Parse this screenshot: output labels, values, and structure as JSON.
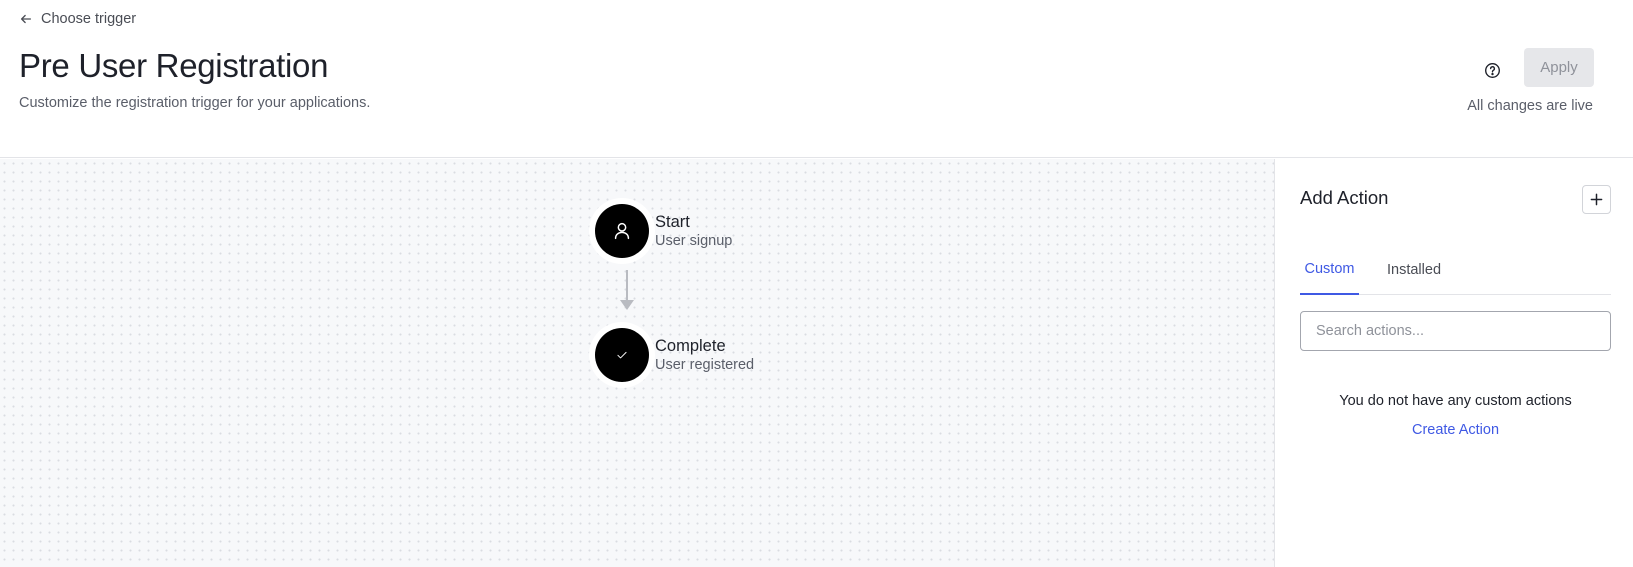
{
  "header": {
    "back_label": "Choose trigger",
    "title": "Pre User Registration",
    "subtitle": "Customize the registration trigger for your applications.",
    "apply_label": "Apply",
    "status": "All changes are live"
  },
  "flow": {
    "nodes": [
      {
        "title": "Start",
        "subtitle": "User signup",
        "icon": "user-icon"
      },
      {
        "title": "Complete",
        "subtitle": "User registered",
        "icon": "check-icon"
      }
    ]
  },
  "panel": {
    "title": "Add Action",
    "tabs": [
      {
        "label": "Custom",
        "active": true
      },
      {
        "label": "Installed",
        "active": false
      }
    ],
    "search_placeholder": "Search actions...",
    "empty_message": "You do not have any custom actions",
    "create_link": "Create Action"
  },
  "colors": {
    "accent": "#3f59e4",
    "node_fill": "#000000",
    "canvas_bg": "#f7f8fa"
  }
}
